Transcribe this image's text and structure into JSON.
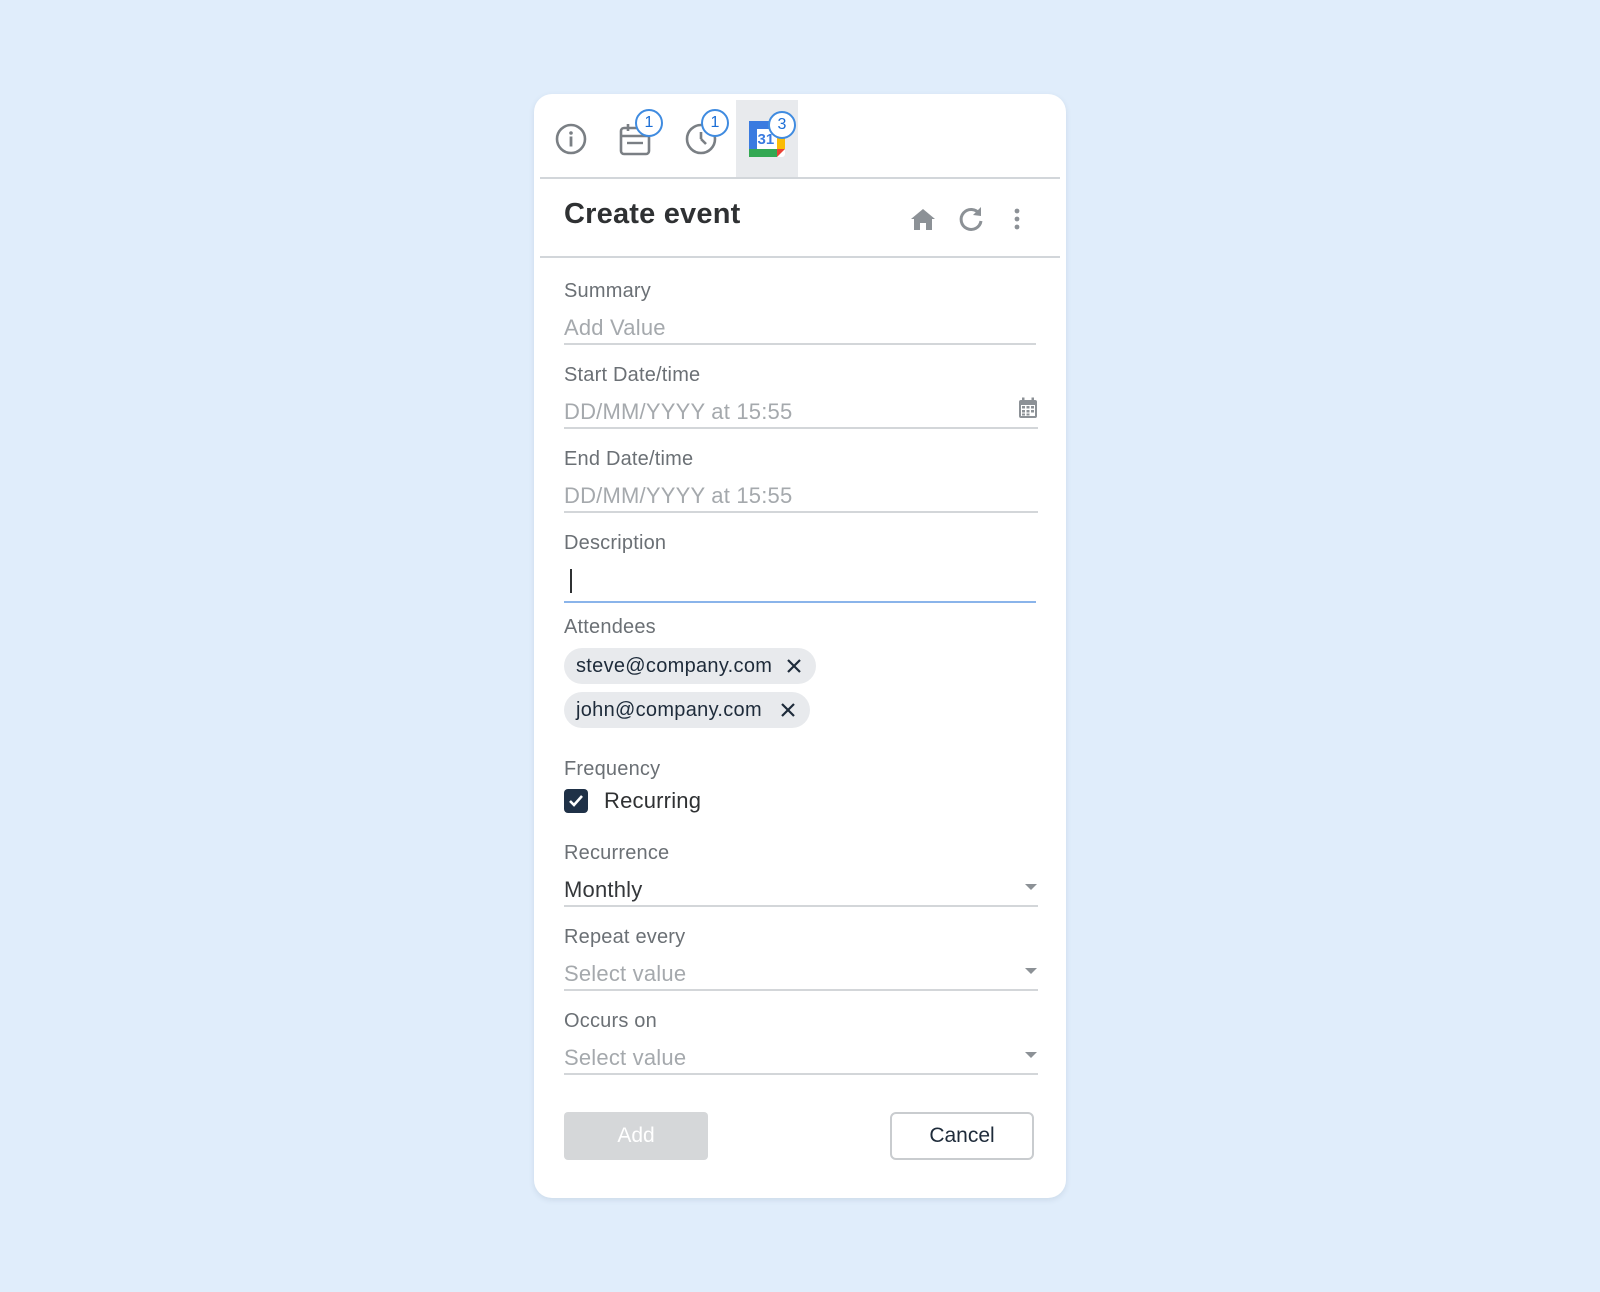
{
  "tabs": [
    {
      "icon": "info-icon",
      "badge": ""
    },
    {
      "icon": "calendar-icon",
      "badge": "1"
    },
    {
      "icon": "clock-icon",
      "badge": "1"
    },
    {
      "icon": "google-calendar-icon",
      "badge": "3",
      "logo_text": "31",
      "active": true
    }
  ],
  "header": {
    "title": "Create event",
    "icons": [
      "home-icon",
      "refresh-icon",
      "more-vertical-icon"
    ]
  },
  "form": {
    "summary": {
      "label": "Summary",
      "placeholder": "Add Value"
    },
    "start": {
      "label": "Start Date/time",
      "placeholder": "DD/MM/YYYY at 15:55",
      "icon": "calendar-grid-icon"
    },
    "end": {
      "label": "End Date/time",
      "placeholder": "DD/MM/YYYY at 15:55"
    },
    "description": {
      "label": "Description",
      "value": ""
    },
    "attendees": {
      "label": "Attendees",
      "chips": [
        "steve@company.com",
        "john@company.com"
      ]
    },
    "frequency": {
      "label": "Frequency",
      "checkbox_label": "Recurring",
      "checked": true
    },
    "recurrence": {
      "label": "Recurrence",
      "value": "Monthly"
    },
    "repeat_every": {
      "label": "Repeat every",
      "placeholder": "Select value"
    },
    "occurs_on": {
      "label": "Occurs on",
      "placeholder": "Select value"
    }
  },
  "actions": {
    "add_label": "Add",
    "cancel_label": "Cancel"
  },
  "colors": {
    "background": "#E0EDFB",
    "badge": "#3F8BE0",
    "checkbox": "#1F3147",
    "focus_underline": "#8AB4EA"
  }
}
